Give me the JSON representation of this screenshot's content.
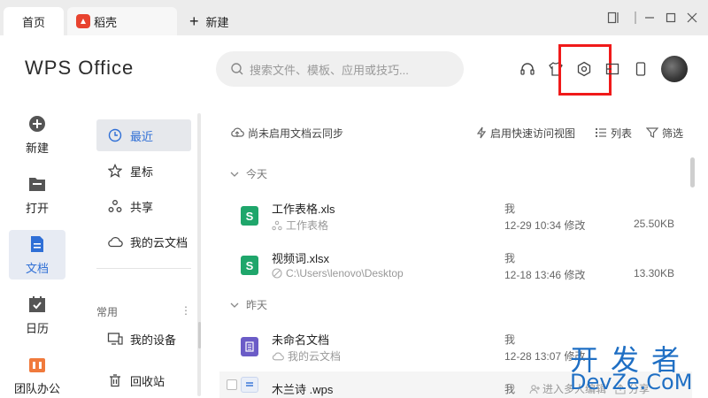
{
  "tabs": {
    "home": "首页",
    "docer": "稻壳",
    "new": "新建"
  },
  "header": {
    "logo": "WPS Office",
    "search_placeholder": "搜索文件、模板、应用或技巧..."
  },
  "rail": {
    "items": [
      {
        "label": "新建",
        "icon": "plus-circle-icon"
      },
      {
        "label": "打开",
        "icon": "folder-icon"
      },
      {
        "label": "文档",
        "icon": "document-icon"
      },
      {
        "label": "日历",
        "icon": "calendar-icon"
      },
      {
        "label": "团队办公",
        "icon": "team-icon"
      }
    ]
  },
  "nav": {
    "items": [
      {
        "label": "最近",
        "icon": "clock-icon"
      },
      {
        "label": "星标",
        "icon": "star-icon"
      },
      {
        "label": "共享",
        "icon": "share-icon"
      },
      {
        "label": "我的云文档",
        "icon": "cloud-icon"
      }
    ],
    "section_title": "常用",
    "section_items": [
      {
        "label": "我的设备",
        "icon": "device-icon"
      },
      {
        "label": "回收站",
        "icon": "trash-icon"
      }
    ]
  },
  "toolbar": {
    "cloud_sync": "尚未启用文档云同步",
    "quick_access": "启用快速访问视图",
    "list": "列表",
    "filter": "筛选"
  },
  "groups": {
    "today": "今天",
    "yesterday": "昨天"
  },
  "files": [
    {
      "name": "工作表格.xls",
      "location": "工作表格",
      "owner": "我",
      "time": "12-29 10:34 修改",
      "size": "25.50KB",
      "type": "xls"
    },
    {
      "name": "视频词.xlsx",
      "location": "C:\\Users\\lenovo\\Desktop",
      "owner": "我",
      "time": "12-18 13:46 修改",
      "size": "13.30KB",
      "type": "xls"
    },
    {
      "name": "未命名文档",
      "location": "我的云文档",
      "owner": "我",
      "time": "12-28 13:07 修改",
      "size": "",
      "type": "doc"
    },
    {
      "name": "木兰诗 .wps",
      "location": "",
      "owner": "我",
      "time": "",
      "size": "",
      "type": "wps",
      "actions": [
        "进入多人编辑",
        "分享"
      ]
    }
  ],
  "watermark": {
    "cn": "开发者",
    "en": "DevZe.CoM"
  },
  "colors": {
    "accent": "#2f6fd6",
    "highlight_box": "#f01a1a",
    "xls": "#1fa66b",
    "doc": "#6b5cc7"
  }
}
